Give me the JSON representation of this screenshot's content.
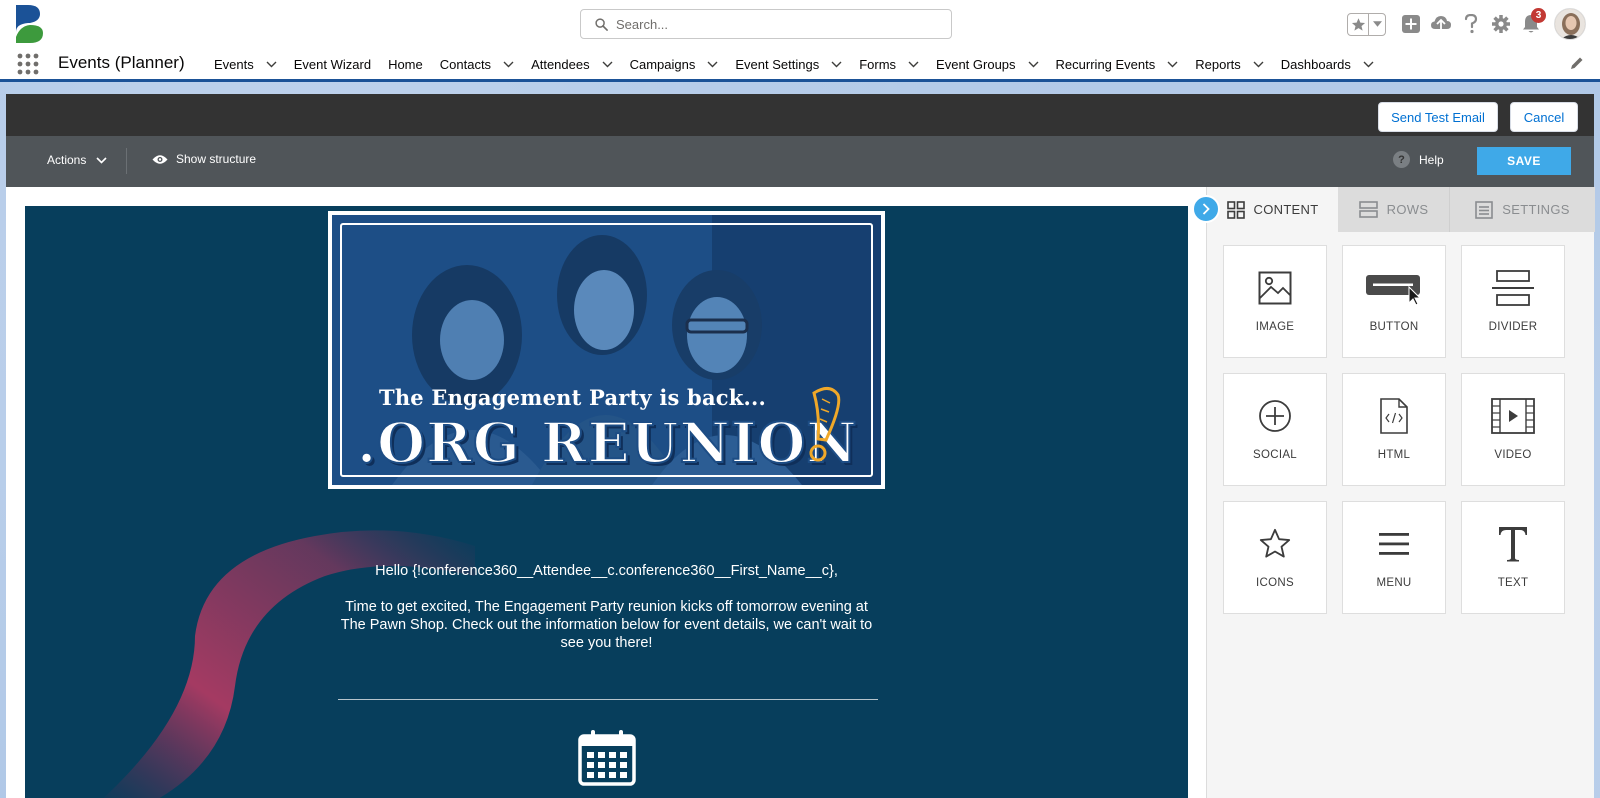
{
  "header": {
    "search_placeholder": "Search...",
    "notification_count": "3"
  },
  "nav": {
    "app_name": "Events (Planner)",
    "items": [
      {
        "label": "Events",
        "dropdown": true
      },
      {
        "label": "Event Wizard",
        "dropdown": false
      },
      {
        "label": "Home",
        "dropdown": false
      },
      {
        "label": "Contacts",
        "dropdown": true
      },
      {
        "label": "Attendees",
        "dropdown": true
      },
      {
        "label": "Campaigns",
        "dropdown": true
      },
      {
        "label": "Event Settings",
        "dropdown": true
      },
      {
        "label": "Forms",
        "dropdown": true
      },
      {
        "label": "Event Groups",
        "dropdown": true
      },
      {
        "label": "Recurring Events",
        "dropdown": true
      },
      {
        "label": "Reports",
        "dropdown": true
      },
      {
        "label": "Dashboards",
        "dropdown": true
      }
    ]
  },
  "editor": {
    "send_test_email": "Send Test Email",
    "cancel": "Cancel",
    "actions": "Actions",
    "show_structure": "Show structure",
    "help": "Help",
    "save": "SAVE"
  },
  "email": {
    "hero_subtitle": "The Engagement Party is back...",
    "hero_title": ".ORG REUNION",
    "greeting": "Hello {!conference360__Attendee__c.conference360__First_Name__c},",
    "body": "Time to get excited, The Engagement Party reunion kicks off tomorrow evening at The Pawn Shop. Check out the information below for event details, we can't wait to see you there!"
  },
  "panel": {
    "tabs": {
      "content": "CONTENT",
      "rows": "ROWS",
      "settings": "SETTINGS"
    },
    "tiles": [
      {
        "label": "IMAGE",
        "icon": "image-icon"
      },
      {
        "label": "BUTTON",
        "icon": "button-icon"
      },
      {
        "label": "DIVIDER",
        "icon": "divider-icon"
      },
      {
        "label": "SOCIAL",
        "icon": "social-icon"
      },
      {
        "label": "HTML",
        "icon": "html-icon"
      },
      {
        "label": "VIDEO",
        "icon": "video-icon"
      },
      {
        "label": "ICONS",
        "icon": "star-icon"
      },
      {
        "label": "MENU",
        "icon": "menu-icon"
      },
      {
        "label": "TEXT",
        "icon": "text-icon"
      }
    ]
  },
  "colors": {
    "brand_blue": "#1b5297",
    "email_bg": "#073e5c",
    "save_blue": "#3fa9e8",
    "toolbar_dark": "#333333",
    "toolbar_gray": "#505559",
    "accent_yellow": "#f0a829"
  }
}
